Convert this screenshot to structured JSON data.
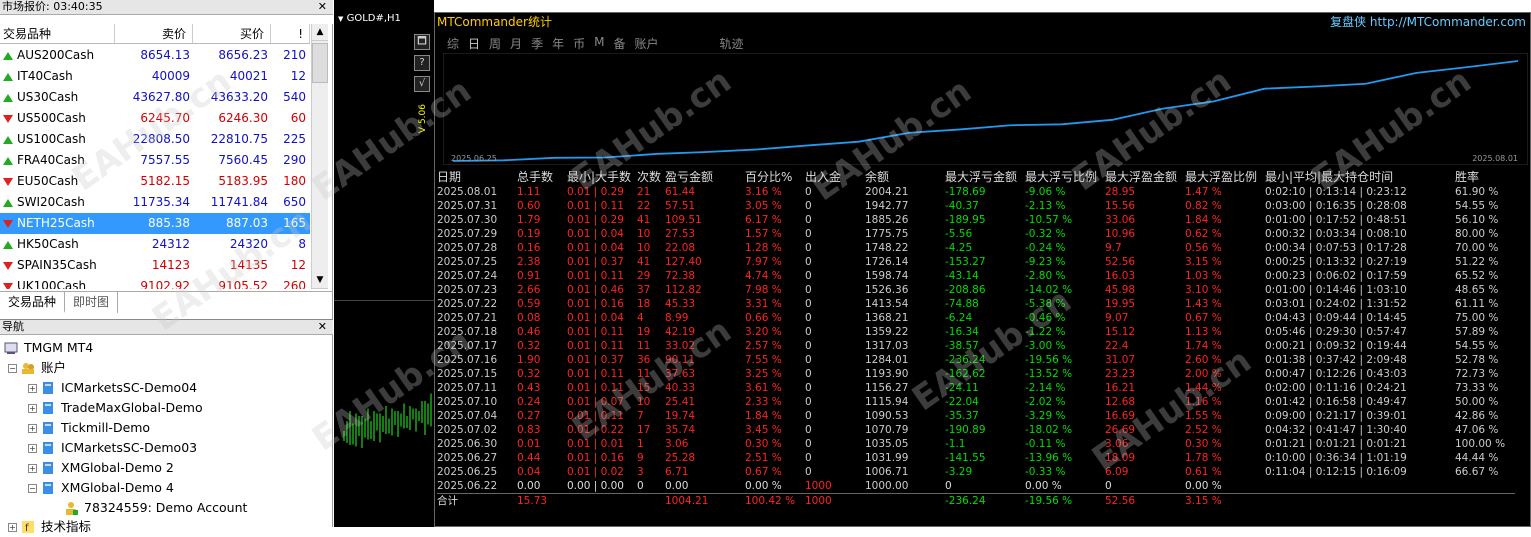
{
  "market": {
    "title": "市场报价: 03:40:35",
    "cols": {
      "symbol": "交易品种",
      "bid": "卖价",
      "ask": "买价",
      "spread": "!"
    },
    "rows": [
      {
        "dir": "up",
        "sym": "AUS200Cash",
        "bid": "8654.13",
        "ask": "8656.23",
        "sp": "210",
        "c": "blue"
      },
      {
        "dir": "up",
        "sym": "IT40Cash",
        "bid": "40009",
        "ask": "40021",
        "sp": "12",
        "c": "blue"
      },
      {
        "dir": "up",
        "sym": "US30Cash",
        "bid": "43627.80",
        "ask": "43633.20",
        "sp": "540",
        "c": "blue"
      },
      {
        "dir": "dn",
        "sym": "US500Cash",
        "bid": "6245.70",
        "ask": "6246.30",
        "sp": "60",
        "c": "red"
      },
      {
        "dir": "up",
        "sym": "US100Cash",
        "bid": "22808.50",
        "ask": "22810.75",
        "sp": "225",
        "c": "blue"
      },
      {
        "dir": "up",
        "sym": "FRA40Cash",
        "bid": "7557.55",
        "ask": "7560.45",
        "sp": "290",
        "c": "blue"
      },
      {
        "dir": "dn",
        "sym": "EU50Cash",
        "bid": "5182.15",
        "ask": "5183.95",
        "sp": "180",
        "c": "red"
      },
      {
        "dir": "up",
        "sym": "SWI20Cash",
        "bid": "11735.34",
        "ask": "11741.84",
        "sp": "650",
        "c": "blue"
      },
      {
        "dir": "dn",
        "sym": "NETH25Cash",
        "bid": "885.38",
        "ask": "887.03",
        "sp": "165",
        "c": "blue",
        "sel": true
      },
      {
        "dir": "up",
        "sym": "HK50Cash",
        "bid": "24312",
        "ask": "24320",
        "sp": "8",
        "c": "blue"
      },
      {
        "dir": "dn",
        "sym": "SPAIN35Cash",
        "bid": "14123",
        "ask": "14135",
        "sp": "12",
        "c": "red"
      },
      {
        "dir": "dn",
        "sym": "UK100Cash",
        "bid": "9102.92",
        "ask": "9105.52",
        "sp": "260",
        "c": "red"
      }
    ],
    "tabs": [
      "交易品种",
      "即时图"
    ]
  },
  "navigator": {
    "title": "导航",
    "root": "TMGM MT4",
    "accounts": "账户",
    "items": [
      "ICMarketsSC-Demo04",
      "TradeMaxGlobal-Demo",
      "Tickmill-Demo",
      "ICMarketsSC-Demo03",
      "XMGlobal-Demo 2",
      "XMGlobal-Demo 4"
    ],
    "account": "78324559: Demo Account",
    "indicators": "技术指标"
  },
  "chart": {
    "title": "GOLD#,H1",
    "side": "V 5.06"
  },
  "stats": {
    "title": "MTCommander统计",
    "brand": "复盘侠",
    "url": "http://MTCommander.com",
    "periods": [
      "综",
      "日",
      "周",
      "月",
      "季",
      "年",
      "币",
      "M",
      "备",
      "账户",
      "轨迹"
    ],
    "active_period": "日",
    "equity_start": "2025.06.25",
    "equity_end": "2025.08.01",
    "equity": [
      1000,
      1006.71,
      1031.99,
      1035.05,
      1070.79,
      1090.53,
      1115.94,
      1156.27,
      1193.9,
      1284.01,
      1317.03,
      1359.22,
      1368.21,
      1413.54,
      1526.36,
      1598.74,
      1726.14,
      1748.22,
      1775.75,
      1885.26,
      1942.77,
      2004.21
    ],
    "headers": [
      "日期",
      "总手数",
      "最小|大手数",
      "次数",
      "盈亏金额",
      "百分比%",
      "出入金",
      "余额",
      "最大浮亏金额",
      "最大浮亏比例",
      "最大浮盈金额",
      "最大浮盈比例",
      "最小|平均|最大持仓时间",
      "胜率"
    ],
    "rows": [
      [
        "2025.08.01",
        "1.11",
        "0.01 | 0.29",
        "21",
        "61.44",
        "3.16 %",
        "0",
        "2004.21",
        "-178.69",
        "-9.06 %",
        "28.95",
        "1.47 %",
        "0:02:10 | 0:13:14 | 0:23:12",
        "61.90 %"
      ],
      [
        "2025.07.31",
        "0.60",
        "0.01 | 0.11",
        "22",
        "57.51",
        "3.05 %",
        "0",
        "1942.77",
        "-40.37",
        "-2.13 %",
        "15.56",
        "0.82 %",
        "0:03:00 | 0:16:35 | 0:28:08",
        "54.55 %"
      ],
      [
        "2025.07.30",
        "1.79",
        "0.01 | 0.29",
        "41",
        "109.51",
        "6.17 %",
        "0",
        "1885.26",
        "-189.95",
        "-10.57 %",
        "33.06",
        "1.84 %",
        "0:01:00 | 0:17:52 | 0:48:51",
        "56.10 %"
      ],
      [
        "2025.07.29",
        "0.19",
        "0.01 | 0.04",
        "10",
        "27.53",
        "1.57 %",
        "0",
        "1775.75",
        "-5.56",
        "-0.32 %",
        "10.96",
        "0.62 %",
        "0:00:32 | 0:03:34 | 0:08:10",
        "80.00 %"
      ],
      [
        "2025.07.28",
        "0.16",
        "0.01 | 0.04",
        "10",
        "22.08",
        "1.28 %",
        "0",
        "1748.22",
        "-4.25",
        "-0.24 %",
        "9.7",
        "0.56 %",
        "0:00:34 | 0:07:53 | 0:17:28",
        "70.00 %"
      ],
      [
        "2025.07.25",
        "2.38",
        "0.01 | 0.37",
        "41",
        "127.40",
        "7.97 %",
        "0",
        "1726.14",
        "-153.27",
        "-9.23 %",
        "52.56",
        "3.15 %",
        "0:00:25 | 0:13:32 | 0:27:19",
        "51.22 %"
      ],
      [
        "2025.07.24",
        "0.91",
        "0.01 | 0.11",
        "29",
        "72.38",
        "4.74 %",
        "0",
        "1598.74",
        "-43.14",
        "-2.80 %",
        "16.03",
        "1.03 %",
        "0:00:23 | 0:06:02 | 0:17:59",
        "65.52 %"
      ],
      [
        "2025.07.23",
        "2.66",
        "0.01 | 0.46",
        "37",
        "112.82",
        "7.98 %",
        "0",
        "1526.36",
        "-208.86",
        "-14.02 %",
        "45.98",
        "3.10 %",
        "0:01:00 | 0:14:46 | 1:03:10",
        "48.65 %"
      ],
      [
        "2025.07.22",
        "0.59",
        "0.01 | 0.16",
        "18",
        "45.33",
        "3.31 %",
        "0",
        "1413.54",
        "-74.88",
        "-5.38 %",
        "19.95",
        "1.43 %",
        "0:03:01 | 0:24:02 | 1:31:52",
        "61.11 %"
      ],
      [
        "2025.07.21",
        "0.08",
        "0.01 | 0.04",
        "4",
        "8.99",
        "0.66 %",
        "0",
        "1368.21",
        "-6.24",
        "-0.46 %",
        "9.07",
        "0.67 %",
        "0:04:43 | 0:09:44 | 0:14:45",
        "75.00 %"
      ],
      [
        "2025.07.18",
        "0.46",
        "0.01 | 0.11",
        "19",
        "42.19",
        "3.20 %",
        "0",
        "1359.22",
        "-16.34",
        "-1.22 %",
        "15.12",
        "1.13 %",
        "0:05:46 | 0:29:30 | 0:57:47",
        "57.89 %"
      ],
      [
        "2025.07.17",
        "0.32",
        "0.01 | 0.11",
        "11",
        "33.02",
        "2.57 %",
        "0",
        "1317.03",
        "-38.57",
        "-3.00 %",
        "22.4",
        "1.74 %",
        "0:00:21 | 0:09:32 | 0:19:44",
        "54.55 %"
      ],
      [
        "2025.07.16",
        "1.90",
        "0.01 | 0.37",
        "36",
        "90.11",
        "7.55 %",
        "0",
        "1284.01",
        "-236.24",
        "-19.56 %",
        "31.07",
        "2.60 %",
        "0:01:38 | 0:37:42 | 2:09:48",
        "52.78 %"
      ],
      [
        "2025.07.15",
        "0.32",
        "0.01 | 0.11",
        "11",
        "37.63",
        "3.25 %",
        "0",
        "1193.90",
        "-162.62",
        "-13.52 %",
        "23.23",
        "2.00 %",
        "0:00:47 | 0:12:26 | 0:43:03",
        "72.73 %"
      ],
      [
        "2025.07.11",
        "0.43",
        "0.01 | 0.11",
        "15",
        "40.33",
        "3.61 %",
        "0",
        "1156.27",
        "-24.11",
        "-2.14 %",
        "16.21",
        "1.44 %",
        "0:02:00 | 0:11:16 | 0:24:21",
        "73.33 %"
      ],
      [
        "2025.07.10",
        "0.24",
        "0.01 | 0.07",
        "10",
        "25.41",
        "2.33 %",
        "0",
        "1115.94",
        "-22.04",
        "-2.02 %",
        "12.68",
        "1.16 %",
        "0:01:42 | 0:16:58 | 0:49:47",
        "50.00 %"
      ],
      [
        "2025.07.04",
        "0.27",
        "0.01 | 0.11",
        "7",
        "19.74",
        "1.84 %",
        "0",
        "1090.53",
        "-35.37",
        "-3.29 %",
        "16.69",
        "1.55 %",
        "0:09:00 | 0:21:17 | 0:39:01",
        "42.86 %"
      ],
      [
        "2025.07.02",
        "0.83",
        "0.01 | 0.22",
        "17",
        "35.74",
        "3.45 %",
        "0",
        "1070.79",
        "-190.89",
        "-18.02 %",
        "26.69",
        "2.52 %",
        "0:04:32 | 0:41:47 | 1:30:40",
        "47.06 %"
      ],
      [
        "2025.06.30",
        "0.01",
        "0.01 | 0.01",
        "1",
        "3.06",
        "0.30 %",
        "0",
        "1035.05",
        "-1.1",
        "-0.11 %",
        "3.06",
        "0.30 %",
        "0:01:21 | 0:01:21 | 0:01:21",
        "100.00 %"
      ],
      [
        "2025.06.27",
        "0.44",
        "0.01 | 0.16",
        "9",
        "25.28",
        "2.51 %",
        "0",
        "1031.99",
        "-141.55",
        "-13.96 %",
        "18.09",
        "1.78 %",
        "0:10:00 | 0:36:34 | 1:01:19",
        "44.44 %"
      ],
      [
        "2025.06.25",
        "0.04",
        "0.01 | 0.02",
        "3",
        "6.71",
        "0.67 %",
        "0",
        "1006.71",
        "-3.29",
        "-0.33 %",
        "6.09",
        "0.61 %",
        "0:11:04 | 0:12:15 | 0:16:09",
        "66.67 %"
      ],
      [
        "2025.06.22",
        "0.00",
        "0.00 | 0.00",
        "0",
        "0.00",
        "0.00 %",
        "1000",
        "1000.00",
        "0",
        "0.00 %",
        "0",
        "0.00 %",
        "",
        ""
      ]
    ],
    "sum": [
      "合计",
      "15.73",
      "",
      "",
      "1004.21",
      "100.42 %",
      "1000",
      "",
      "-236.24",
      "-19.56 %",
      "52.56",
      "3.15 %",
      "",
      ""
    ]
  },
  "watermark": "EAHub.cn"
}
